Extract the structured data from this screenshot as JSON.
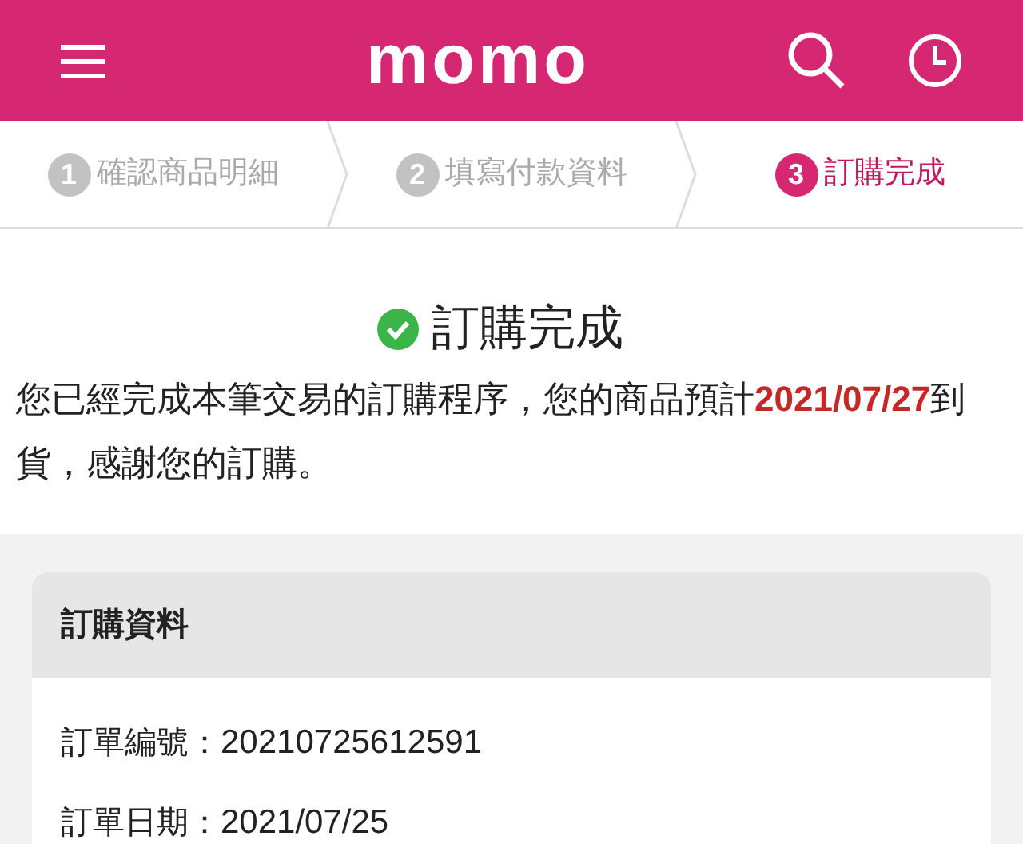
{
  "header": {
    "logo": "momo"
  },
  "steps": [
    {
      "number": "1",
      "label": "確認商品明細",
      "selected": false
    },
    {
      "number": "2",
      "label": "填寫付款資料",
      "selected": false
    },
    {
      "number": "3",
      "label": "訂購完成",
      "selected": true
    }
  ],
  "result": {
    "title": "訂購完成",
    "message": {
      "before": "您已經完成本筆交易的訂購程序，您的商品預計",
      "highlight": "2021/07/27",
      "after": "到貨，感謝您的訂購。"
    }
  },
  "order_card": {
    "title": "訂購資料",
    "fields": [
      {
        "label": "訂單編號：",
        "value": "20210725612591"
      },
      {
        "label": "訂單日期：",
        "value": "2021/07/25"
      }
    ]
  }
}
